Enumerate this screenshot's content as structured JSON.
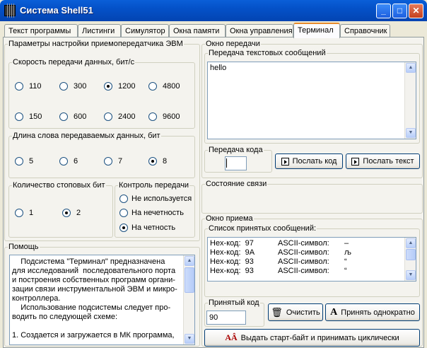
{
  "window": {
    "title": "Система Shell51",
    "min": "_",
    "max": "□",
    "close": "✕"
  },
  "tabs": [
    {
      "label": "Текст программы"
    },
    {
      "label": "Листинги"
    },
    {
      "label": "Симулятор"
    },
    {
      "label": "Окна памяти"
    },
    {
      "label": "Окна управления"
    },
    {
      "label": "Терминал"
    },
    {
      "label": "Справочник"
    }
  ],
  "active_tab": "Терминал",
  "params": {
    "title": "Параметры настройки приемопередатчика ЭВМ",
    "speed": {
      "title": "Скорость передачи данных, бит/с",
      "options": [
        "110",
        "300",
        "1200",
        "4800",
        "150",
        "600",
        "2400",
        "9600"
      ],
      "selected": "1200"
    },
    "word": {
      "title": "Длина слова передаваемых данных, бит",
      "options": [
        "5",
        "6",
        "7",
        "8"
      ],
      "selected": "8"
    },
    "stop": {
      "title": "Количество стоповых бит",
      "options": [
        "1",
        "2"
      ],
      "selected": "2"
    },
    "parity": {
      "title": "Контроль передачи",
      "options": [
        "Не используется",
        "На нечетность",
        "На четность"
      ],
      "selected": "На четность"
    }
  },
  "help": {
    "title": "Помощь",
    "lines": [
      "    Подсистема \"Терминал\" предназначена",
      "для исследований  последовательного порта",
      "и построения собственных программ органи-",
      "зации связи инструментальной ЭВМ и микро-",
      "контроллера.",
      "    Использование подсистемы следует про-",
      "водить по следующей схеме:",
      "",
      "1. Создается и загружается в МК программа,"
    ]
  },
  "transmit": {
    "title": "Окно передачи",
    "text_group": "Передача текстовых сообщений",
    "text_value": "hello",
    "code_group": "Передача кода",
    "code_value": "",
    "send_code": "Послать код",
    "send_text": "Послать текст"
  },
  "link_state": {
    "title": "Состояние связи"
  },
  "receive": {
    "title": "Окно приема",
    "list_group": "Список принятых сообщений:",
    "rows": [
      {
        "hex": "Hex-код:  97",
        "ascii": "ASCII-символ:",
        "ch": "–"
      },
      {
        "hex": "Hex-код:  9A",
        "ascii": "ASCII-символ:",
        "ch": "љ"
      },
      {
        "hex": "Hex-код:  93",
        "ascii": "ASCII-символ:",
        "ch": "“"
      },
      {
        "hex": "Hex-код:  93",
        "ascii": "ASCII-символ:",
        "ch": "“"
      }
    ],
    "code_group": "Принятый код",
    "code_value": "90",
    "clear": "Очистить",
    "receive_once": "Принять однократно",
    "receive_cyclic": "Выдать старт-байт и принимать циклически"
  }
}
